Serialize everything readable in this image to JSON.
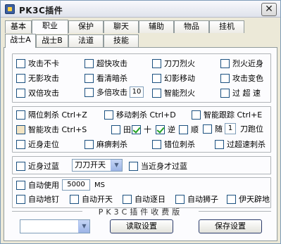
{
  "window": {
    "title": "PK3C插件",
    "close_glyph": "✕"
  },
  "tabs_row1": [
    "基本",
    "职业",
    "保护",
    "聊天",
    "辅助",
    "物品",
    "挂机"
  ],
  "tabs_row2": [
    "战士A",
    "战士B",
    "法道",
    "技能"
  ],
  "group1": {
    "items": [
      "攻击不卡",
      "超快攻击",
      "刀刀烈火",
      "烈火近身",
      "无影攻击",
      "看清暗杀",
      "幻影移动",
      "攻击变色",
      "双倍攻击",
      "多倍攻击",
      "智能烈火",
      "过 超 速"
    ],
    "multi_attack_value": "10"
  },
  "group2": {
    "gap_kill": "隔位刺杀 Ctrl+Z",
    "move_kill": "移动刺杀 Ctrl+D",
    "smart_follow": "智能跟踪 Ctrl+E",
    "smart_attack": "智能攻击 Ctrl+S",
    "dir_tian": "田",
    "dir_shi": "十",
    "dir_ni": "逆",
    "dir_shun": "顺",
    "random": "随",
    "random_value": "1",
    "blade_run": "刀跑位",
    "near_move": "近身走位",
    "paralyze_kill": "麻痹刺杀",
    "misplace_kill": "错位刺杀",
    "super_speed_kill": "过超速刺杀"
  },
  "group3": {
    "near_blue": "近身过蓝",
    "combo_value": "刀刀开天",
    "near_only_blue": "当近身才过蓝"
  },
  "group4": {
    "auto_use": "自动使用",
    "ms_value": "5000",
    "ms_unit": "MS",
    "items": [
      "自动地钉",
      "自动开天",
      "自动逐日",
      "自动狮子",
      "伊天辟地"
    ]
  },
  "footer": {
    "title": "PK3C插件收费版",
    "read_button": "读取设置",
    "save_button": "保存设置",
    "combo_value": ""
  }
}
